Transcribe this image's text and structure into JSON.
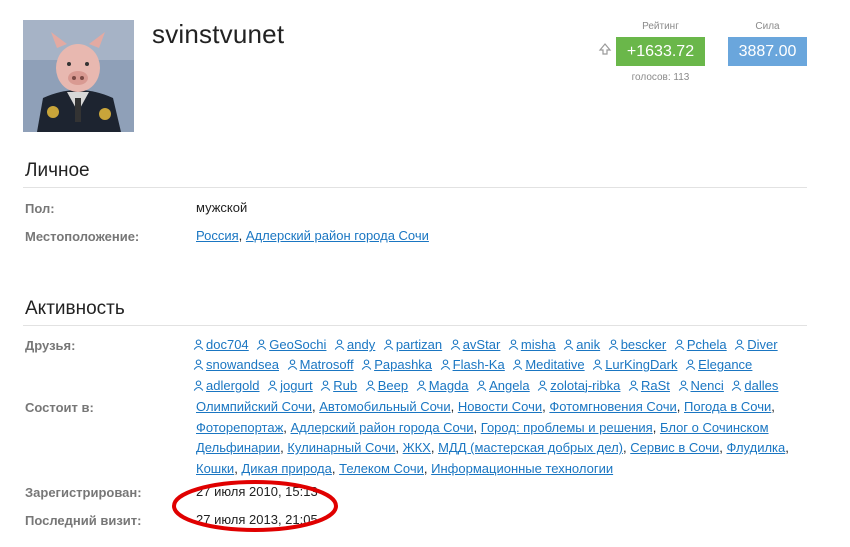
{
  "profile": {
    "username": "svinstvunet",
    "rating_label": "Рейтинг",
    "rating_value": "+1633.72",
    "votes_text": "голосов: 113",
    "power_label": "Сила",
    "power_value": "3887.00"
  },
  "personal": {
    "title": "Личное",
    "gender_label": "Пол:",
    "gender_value": "мужской",
    "location_label": "Местоположение:",
    "location_country": "Россия",
    "location_comma": ",",
    "location_place": "Адлерский район города Сочи"
  },
  "activity": {
    "title": "Активность",
    "friends_label": "Друзья:",
    "friends": [
      "doc704",
      "GeoSochi",
      "andy",
      "partizan",
      "avStar",
      "misha",
      "anik",
      "bescker",
      "Pchela",
      "Diver",
      "snowandsea",
      "Matrosoff",
      "Papashka",
      "Flash-Ka",
      "Meditative",
      "LurKingDark",
      "Elegance",
      "adlergold",
      "jogurt",
      "Rub",
      "Beep",
      "Magda",
      "Angela",
      "zolotaj-ribka",
      "RaSt",
      "Nenci",
      "dalles"
    ],
    "groups_label": "Состоит в:",
    "groups": [
      "Олимпийский Сочи",
      "Автомобильный Сочи",
      "Новости Сочи",
      "Фотомгновения Сочи",
      "Погода в Сочи",
      "Фоторепортаж",
      "Адлерский район города Сочи",
      "Город: проблемы и решения",
      "Блог о Сочинском Дельфинарии",
      "Кулинарный Сочи",
      "ЖКХ",
      "МДД (мастерская добрых дел)",
      "Сервис в Сочи",
      "Флудилка",
      "Кошки",
      "Дикая природа",
      "Телеком Сочи",
      "Информационные технологии"
    ],
    "registered_label": "Зарегистрирован:",
    "registered_value": "27 июля 2010, 15:13",
    "last_visit_label": "Последний визит:",
    "last_visit_value": "27 июля 2013, 21:05"
  },
  "colors": {
    "rating": "#6ab74a",
    "power": "#6aa6dc",
    "link": "#1a76c2",
    "highlight_circle": "#e00000"
  },
  "icons": {
    "vote_up": "thumb-up-icon",
    "friend": "user-icon"
  }
}
